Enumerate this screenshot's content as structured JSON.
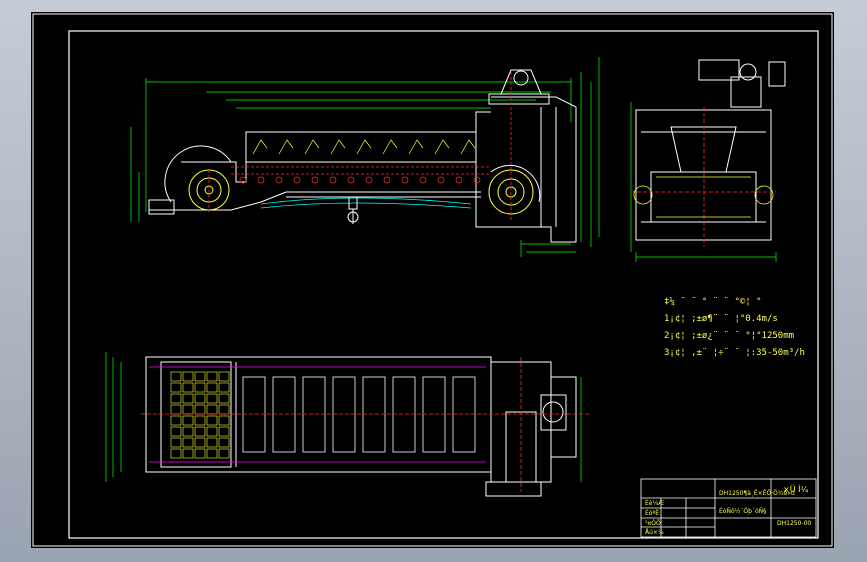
{
  "drawing": {
    "colors": {
      "background": "#000000",
      "frame": "#ffffff",
      "outline": "#ffffff",
      "dimension": "#00ff00",
      "centerline": "#ff2a2a",
      "hatch": "#ffff33",
      "hidden": "#00ffff",
      "accent": "#ff00ff",
      "viewer_bg": "#b5bcc7"
    },
    "tech_notes": {
      "title": "‡¼ ¨ ¨ ° ¨ ¨ °©¦ ° ",
      "lines": [
        "1¡¢¦ ;±ø¶¨ ¨ ¦°0.4m/s",
        "2¡¢¦ ;±ø¿¨ ¨ ¨ °¦°1250mm",
        "3¡¢¦ ,±¨ ¦÷¨ ¨ ¦:35-50m³/h"
      ]
    },
    "title_block": {
      "drawing_name": "DH1250¶à¸Ë×ÊÖ·Ö¼ð»ú",
      "sheet_type": "×Ü Í¼",
      "drawing_no": "DH1250-00",
      "school": "ÉòÑô½¨Öþ´óÑ§",
      "designer": "Éè¼Æ",
      "checker": "ÉóºË",
      "approver": "Åú×¼",
      "process": "¹¤ÒÕ"
    }
  }
}
